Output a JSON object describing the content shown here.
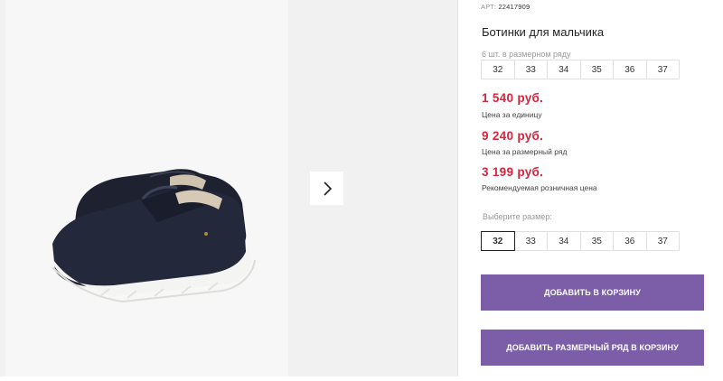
{
  "product": {
    "article_label": "АРТ:",
    "article_value": "22417909",
    "title": "Ботинки для мальчика",
    "pack_note": "6 шт. в размерном ряду",
    "pack_sizes": [
      "32",
      "33",
      "34",
      "35",
      "36",
      "37"
    ],
    "prices": [
      {
        "value": "1 540 руб.",
        "label": "Цена за единицу"
      },
      {
        "value": "9 240 руб.",
        "label": "Цена за размерный ряд"
      },
      {
        "value": "3 199 руб.",
        "label": "Рекомендуемая розничная цена"
      }
    ],
    "choose_label": "Выберите размер:",
    "select_sizes": [
      "32",
      "33",
      "34",
      "35",
      "36",
      "37"
    ],
    "selected_size": "32",
    "add_to_cart": "Добавить в корзину",
    "add_pack_to_cart": "Добавить размерный ряд в корзину"
  },
  "gallery": {
    "next_icon": "chevron-right-icon",
    "image": "black-velcro-shoes-white-sole"
  },
  "colors": {
    "price": "#d7263d",
    "button": "#7b5ea7",
    "gallery_bg": "#f1f1f1"
  }
}
